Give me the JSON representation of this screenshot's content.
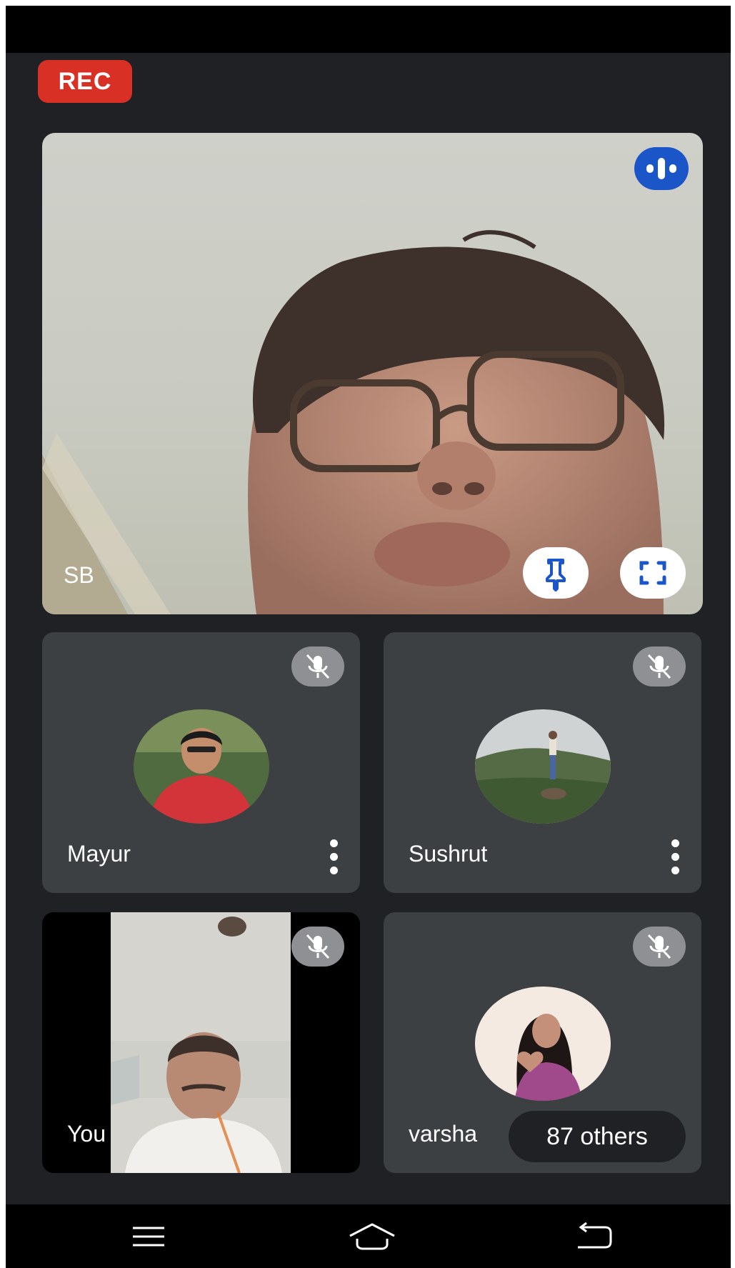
{
  "recording": {
    "label": "REC",
    "color": "#d93025"
  },
  "main_tile": {
    "name": "SB",
    "speaking_icon": "audio-level-icon",
    "pin_icon": "pin-icon",
    "fullscreen_icon": "fullscreen-icon"
  },
  "participants": [
    {
      "name": "Mayur",
      "muted": true,
      "mute_icon": "mic-off-icon",
      "more_icon": "more-vert-icon"
    },
    {
      "name": "Sushrut",
      "muted": true,
      "mute_icon": "mic-off-icon",
      "more_icon": "more-vert-icon"
    },
    {
      "name": "You",
      "muted": true,
      "mute_icon": "mic-off-icon"
    },
    {
      "name": "varsha",
      "muted": true,
      "mute_icon": "mic-off-icon",
      "others_label": "87 others"
    }
  ],
  "nav": {
    "menu_icon": "menu-icon",
    "home_icon": "home-icon",
    "back_icon": "back-icon"
  },
  "colors": {
    "background": "#202124",
    "tile": "#3c4043",
    "accent": "#1a56c8"
  }
}
